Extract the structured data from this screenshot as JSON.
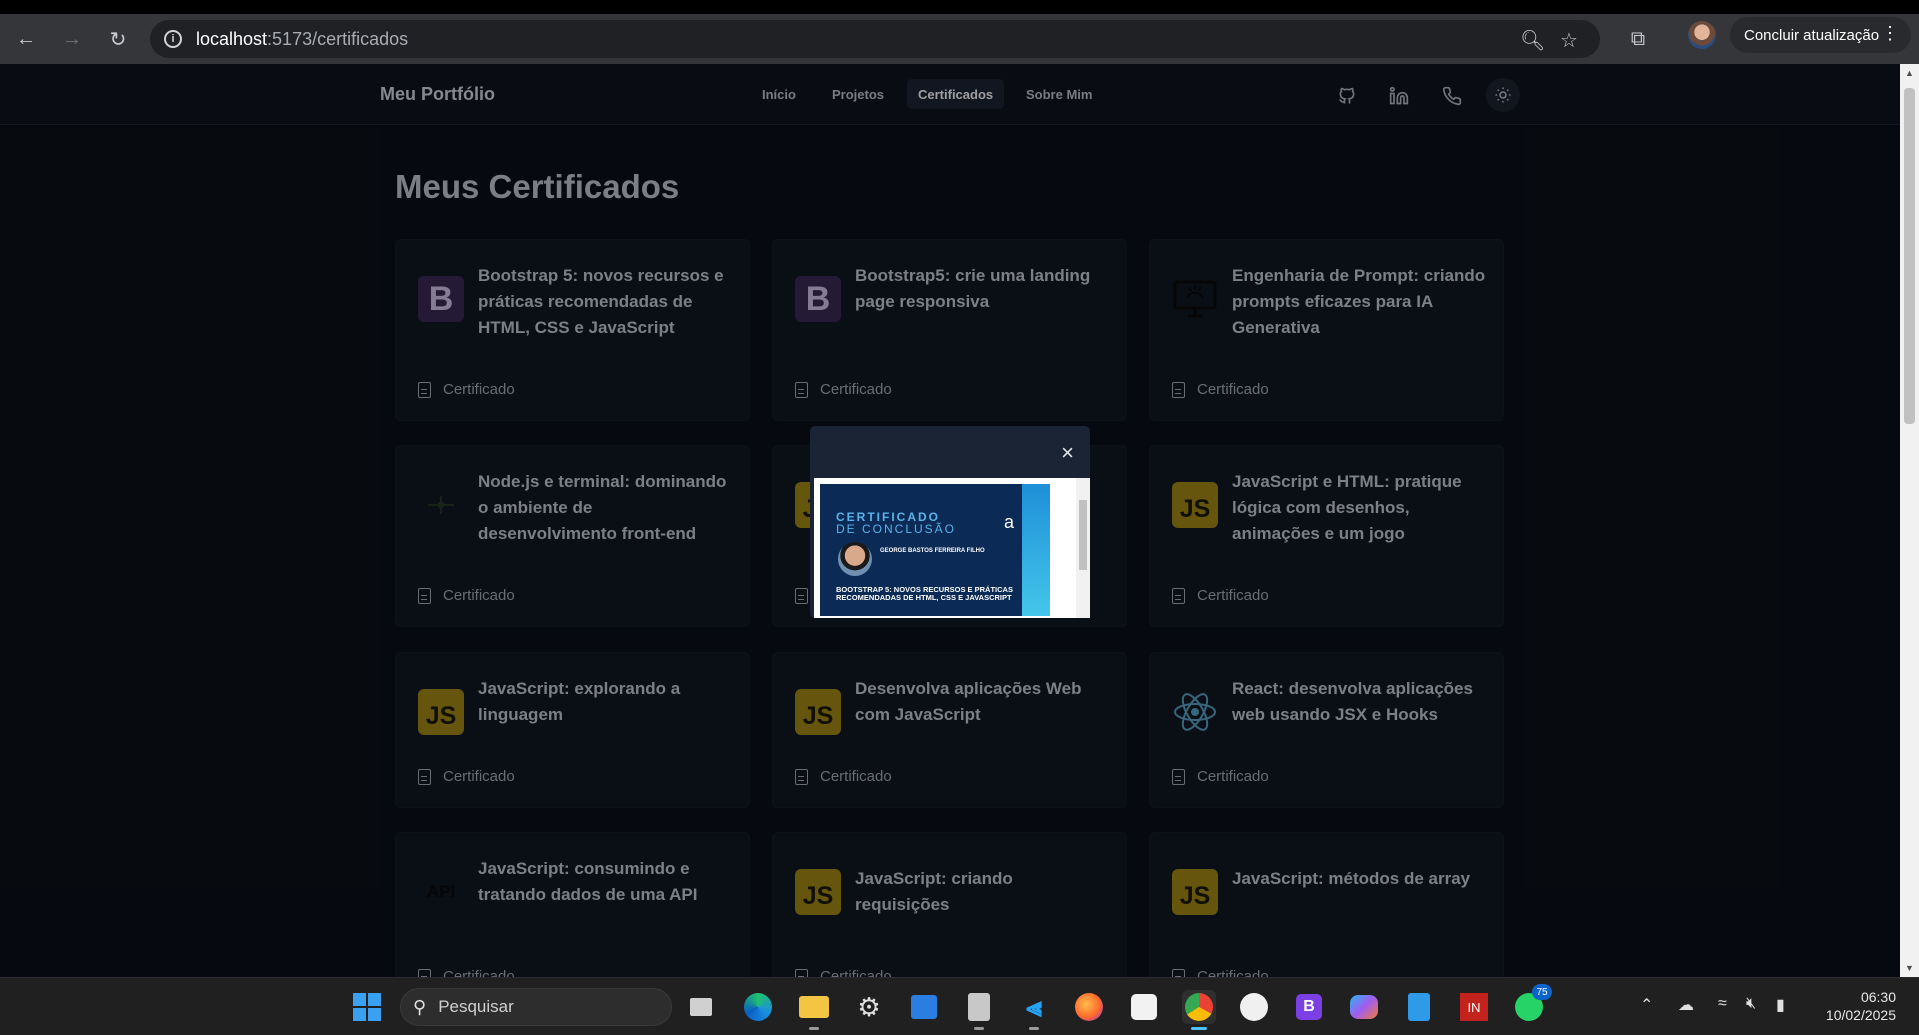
{
  "browser": {
    "url_host": "localhost",
    "url_path": ":5173/certificados",
    "update_label": "Concluir atualização"
  },
  "navbar": {
    "brand": "Meu Portfólio",
    "links": [
      {
        "label": "Início"
      },
      {
        "label": "Projetos"
      },
      {
        "label": "Certificados",
        "active": true
      },
      {
        "label": "Sobre Mim"
      }
    ],
    "icons": [
      "github-icon",
      "linkedin-icon",
      "phone-icon",
      "sun-icon"
    ]
  },
  "page": {
    "title": "Meus Certificados",
    "cert_label": "Certificado"
  },
  "certificates": [
    {
      "title": "Bootstrap 5: novos recursos e práticas recomendadas de HTML, CSS e JavaScript",
      "icon": "bootstrap-icon",
      "icon_text": "B"
    },
    {
      "title": "Bootstrap5: crie uma landing page responsiva",
      "icon": "bootstrap-icon",
      "icon_text": "B"
    },
    {
      "title": "Engenharia de Prompt: criando prompts eficazes para IA Generativa",
      "icon": "ai-monitor-icon"
    },
    {
      "title": "Node.js e terminal: dominando o ambiente de desenvolvimento front-end",
      "icon": "nodejs-icon"
    },
    {
      "title": "",
      "icon": "javascript-icon",
      "icon_text": "JS"
    },
    {
      "title": "JavaScript e HTML: pratique lógica com desenhos, animações e um jogo",
      "icon": "javascript-icon",
      "icon_text": "JS"
    },
    {
      "title": "JavaScript: explorando a linguagem",
      "icon": "javascript-icon",
      "icon_text": "JS"
    },
    {
      "title": "Desenvolva aplicações Web com JavaScript",
      "icon": "javascript-icon",
      "icon_text": "JS"
    },
    {
      "title": "React: desenvolva aplicações web usando JSX e Hooks",
      "icon": "react-icon"
    },
    {
      "title": "JavaScript: consumindo e tratando dados de uma API",
      "icon": "api-icon",
      "icon_text": "API"
    },
    {
      "title": "JavaScript: criando requisições",
      "icon": "javascript-icon",
      "icon_text": "JS"
    },
    {
      "title": "JavaScript: métodos de array",
      "icon": "javascript-icon",
      "icon_text": "JS"
    }
  ],
  "modal": {
    "close_symbol": "×",
    "preview": {
      "heading1": "CERTIFICADO",
      "heading2": "DE CONCLUSÃO",
      "logo_letter": "a",
      "name": "GEORGE BASTOS FERREIRA FILHO",
      "course": "BOOTSTRAP 5: NOVOS RECURSOS E PRÁTICAS RECOMENDADAS DE HTML, CSS E JAVASCRIPT"
    }
  },
  "taskbar": {
    "search_placeholder": "Pesquisar",
    "whatsapp_badge": "75",
    "time": "06:30",
    "date": "10/02/2025"
  },
  "colors": {
    "background": "#0b1019",
    "card": "#111722",
    "bootstrap": "#3b2a57",
    "javascript": "#a58a15",
    "react": "#5aa7c7"
  }
}
